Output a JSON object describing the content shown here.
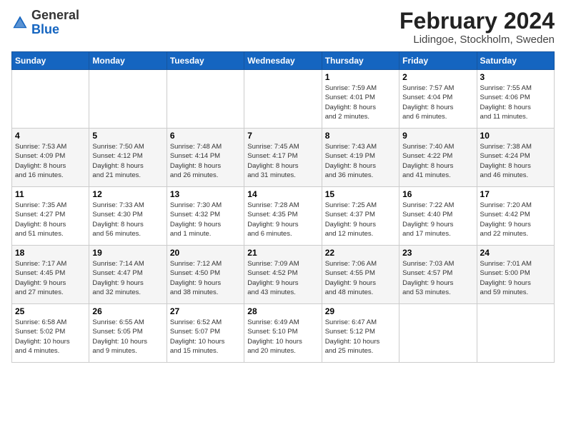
{
  "logo": {
    "general": "General",
    "blue": "Blue"
  },
  "header": {
    "month": "February 2024",
    "location": "Lidingoe, Stockholm, Sweden"
  },
  "weekdays": [
    "Sunday",
    "Monday",
    "Tuesday",
    "Wednesday",
    "Thursday",
    "Friday",
    "Saturday"
  ],
  "weeks": [
    [
      {
        "day": "",
        "info": ""
      },
      {
        "day": "",
        "info": ""
      },
      {
        "day": "",
        "info": ""
      },
      {
        "day": "",
        "info": ""
      },
      {
        "day": "1",
        "info": "Sunrise: 7:59 AM\nSunset: 4:01 PM\nDaylight: 8 hours\nand 2 minutes."
      },
      {
        "day": "2",
        "info": "Sunrise: 7:57 AM\nSunset: 4:04 PM\nDaylight: 8 hours\nand 6 minutes."
      },
      {
        "day": "3",
        "info": "Sunrise: 7:55 AM\nSunset: 4:06 PM\nDaylight: 8 hours\nand 11 minutes."
      }
    ],
    [
      {
        "day": "4",
        "info": "Sunrise: 7:53 AM\nSunset: 4:09 PM\nDaylight: 8 hours\nand 16 minutes."
      },
      {
        "day": "5",
        "info": "Sunrise: 7:50 AM\nSunset: 4:12 PM\nDaylight: 8 hours\nand 21 minutes."
      },
      {
        "day": "6",
        "info": "Sunrise: 7:48 AM\nSunset: 4:14 PM\nDaylight: 8 hours\nand 26 minutes."
      },
      {
        "day": "7",
        "info": "Sunrise: 7:45 AM\nSunset: 4:17 PM\nDaylight: 8 hours\nand 31 minutes."
      },
      {
        "day": "8",
        "info": "Sunrise: 7:43 AM\nSunset: 4:19 PM\nDaylight: 8 hours\nand 36 minutes."
      },
      {
        "day": "9",
        "info": "Sunrise: 7:40 AM\nSunset: 4:22 PM\nDaylight: 8 hours\nand 41 minutes."
      },
      {
        "day": "10",
        "info": "Sunrise: 7:38 AM\nSunset: 4:24 PM\nDaylight: 8 hours\nand 46 minutes."
      }
    ],
    [
      {
        "day": "11",
        "info": "Sunrise: 7:35 AM\nSunset: 4:27 PM\nDaylight: 8 hours\nand 51 minutes."
      },
      {
        "day": "12",
        "info": "Sunrise: 7:33 AM\nSunset: 4:30 PM\nDaylight: 8 hours\nand 56 minutes."
      },
      {
        "day": "13",
        "info": "Sunrise: 7:30 AM\nSunset: 4:32 PM\nDaylight: 9 hours\nand 1 minute."
      },
      {
        "day": "14",
        "info": "Sunrise: 7:28 AM\nSunset: 4:35 PM\nDaylight: 9 hours\nand 6 minutes."
      },
      {
        "day": "15",
        "info": "Sunrise: 7:25 AM\nSunset: 4:37 PM\nDaylight: 9 hours\nand 12 minutes."
      },
      {
        "day": "16",
        "info": "Sunrise: 7:22 AM\nSunset: 4:40 PM\nDaylight: 9 hours\nand 17 minutes."
      },
      {
        "day": "17",
        "info": "Sunrise: 7:20 AM\nSunset: 4:42 PM\nDaylight: 9 hours\nand 22 minutes."
      }
    ],
    [
      {
        "day": "18",
        "info": "Sunrise: 7:17 AM\nSunset: 4:45 PM\nDaylight: 9 hours\nand 27 minutes."
      },
      {
        "day": "19",
        "info": "Sunrise: 7:14 AM\nSunset: 4:47 PM\nDaylight: 9 hours\nand 32 minutes."
      },
      {
        "day": "20",
        "info": "Sunrise: 7:12 AM\nSunset: 4:50 PM\nDaylight: 9 hours\nand 38 minutes."
      },
      {
        "day": "21",
        "info": "Sunrise: 7:09 AM\nSunset: 4:52 PM\nDaylight: 9 hours\nand 43 minutes."
      },
      {
        "day": "22",
        "info": "Sunrise: 7:06 AM\nSunset: 4:55 PM\nDaylight: 9 hours\nand 48 minutes."
      },
      {
        "day": "23",
        "info": "Sunrise: 7:03 AM\nSunset: 4:57 PM\nDaylight: 9 hours\nand 53 minutes."
      },
      {
        "day": "24",
        "info": "Sunrise: 7:01 AM\nSunset: 5:00 PM\nDaylight: 9 hours\nand 59 minutes."
      }
    ],
    [
      {
        "day": "25",
        "info": "Sunrise: 6:58 AM\nSunset: 5:02 PM\nDaylight: 10 hours\nand 4 minutes."
      },
      {
        "day": "26",
        "info": "Sunrise: 6:55 AM\nSunset: 5:05 PM\nDaylight: 10 hours\nand 9 minutes."
      },
      {
        "day": "27",
        "info": "Sunrise: 6:52 AM\nSunset: 5:07 PM\nDaylight: 10 hours\nand 15 minutes."
      },
      {
        "day": "28",
        "info": "Sunrise: 6:49 AM\nSunset: 5:10 PM\nDaylight: 10 hours\nand 20 minutes."
      },
      {
        "day": "29",
        "info": "Sunrise: 6:47 AM\nSunset: 5:12 PM\nDaylight: 10 hours\nand 25 minutes."
      },
      {
        "day": "",
        "info": ""
      },
      {
        "day": "",
        "info": ""
      }
    ]
  ]
}
